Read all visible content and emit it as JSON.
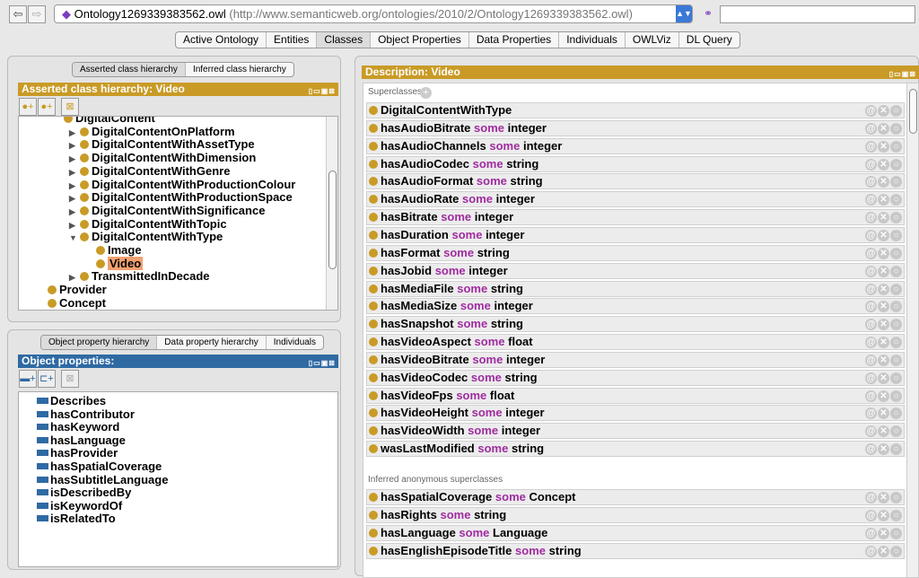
{
  "toolbar": {
    "back_icon": "arrow-left-icon",
    "forward_icon": "arrow-right-icon",
    "ontology_name": "Ontology1269339383562.owl",
    "ontology_iri": "(http://www.semanticweb.org/ontologies/2010/2/Ontology1269339383562.owl)",
    "search_value": ""
  },
  "tabs": [
    "Active Ontology",
    "Entities",
    "Classes",
    "Object Properties",
    "Data Properties",
    "Individuals",
    "OWLViz",
    "DL Query"
  ],
  "selected_tab": "Classes",
  "class_panel": {
    "subtabs": [
      "Asserted class hierarchy",
      "Inferred class hierarchy"
    ],
    "title": "Asserted class hierarchy: Video",
    "tree": [
      {
        "label": "DigitalContent",
        "level": 1,
        "arrow": "",
        "partial": true
      },
      {
        "label": "DigitalContentOnPlatform",
        "level": 2,
        "arrow": "▶"
      },
      {
        "label": "DigitalContentWithAssetType",
        "level": 2,
        "arrow": "▶"
      },
      {
        "label": "DigitalContentWithDimension",
        "level": 2,
        "arrow": "▶"
      },
      {
        "label": "DigitalContentWithGenre",
        "level": 2,
        "arrow": "▶"
      },
      {
        "label": "DigitalContentWithProductionColour",
        "level": 2,
        "arrow": "▶"
      },
      {
        "label": "DigitalContentWithProductionSpace",
        "level": 2,
        "arrow": "▶"
      },
      {
        "label": "DigitalContentWithSignificance",
        "level": 2,
        "arrow": "▶"
      },
      {
        "label": "DigitalContentWithTopic",
        "level": 2,
        "arrow": "▶"
      },
      {
        "label": "DigitalContentWithType",
        "level": 2,
        "arrow": "▼"
      },
      {
        "label": "Image",
        "level": 3,
        "arrow": ""
      },
      {
        "label": "Video",
        "level": 3,
        "arrow": "",
        "selected": true
      },
      {
        "label": "TransmittedInDecade",
        "level": 2,
        "arrow": "▶"
      },
      {
        "label": "Provider",
        "level": 0,
        "arrow": ""
      },
      {
        "label": "Concept",
        "level": 0,
        "arrow": ""
      }
    ]
  },
  "property_panel": {
    "subtabs": [
      "Object property hierarchy",
      "Data property hierarchy",
      "Individuals"
    ],
    "title": "Object properties:",
    "items": [
      "Describes",
      "hasContributor",
      "hasKeyword",
      "hasLanguage",
      "hasProvider",
      "hasSpatialCoverage",
      "hasSubtitleLanguage",
      "isDescribedBy",
      "isKeywordOf",
      "isRelatedTo"
    ]
  },
  "description": {
    "title": "Description: Video",
    "superclasses_label": "Superclasses",
    "inferred_label": "Inferred anonymous superclasses",
    "superclasses": [
      [
        "DigitalContentWithType",
        "",
        ""
      ],
      [
        "hasAudioBitrate",
        "some",
        "integer"
      ],
      [
        "hasAudioChannels",
        "some",
        "integer"
      ],
      [
        "hasAudioCodec",
        "some",
        "string"
      ],
      [
        "hasAudioFormat",
        "some",
        "string"
      ],
      [
        "hasAudioRate",
        "some",
        "integer"
      ],
      [
        "hasBitrate",
        "some",
        "integer"
      ],
      [
        "hasDuration",
        "some",
        "integer"
      ],
      [
        "hasFormat",
        "some",
        "string"
      ],
      [
        "hasJobid",
        "some",
        "integer"
      ],
      [
        "hasMediaFile",
        "some",
        "string"
      ],
      [
        "hasMediaSize",
        "some",
        "integer"
      ],
      [
        "hasSnapshot",
        "some",
        "string"
      ],
      [
        "hasVideoAspect",
        "some",
        "float"
      ],
      [
        "hasVideoBitrate",
        "some",
        "integer"
      ],
      [
        "hasVideoCodec",
        "some",
        "string"
      ],
      [
        "hasVideoFps",
        "some",
        "float"
      ],
      [
        "hasVideoHeight",
        "some",
        "integer"
      ],
      [
        "hasVideoWidth",
        "some",
        "integer"
      ],
      [
        "wasLastModified",
        "some",
        "string"
      ]
    ],
    "inferred": [
      [
        "hasSpatialCoverage",
        "some",
        "Concept"
      ],
      [
        "hasRights",
        "some",
        "string"
      ],
      [
        "hasLanguage",
        "some",
        "Language"
      ],
      [
        "hasEnglishEpisodeTitle",
        "some",
        "string"
      ]
    ]
  },
  "colors": {
    "class_header": "#c99b26",
    "property_header": "#2f6aa3",
    "keyword": "#a02ca0",
    "selection": "#f0a070"
  }
}
